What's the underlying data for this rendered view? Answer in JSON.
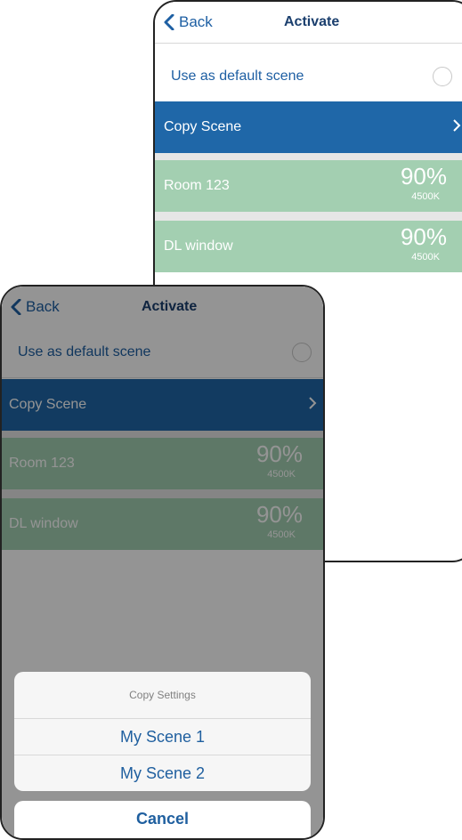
{
  "nav": {
    "back_label": "Back",
    "title": "Activate"
  },
  "scene": {
    "default_label": "Use as default scene",
    "copy_label": "Copy Scene",
    "rooms": [
      {
        "name": "Room 123",
        "level": "90%",
        "kelvin": "4500K"
      },
      {
        "name": "DL window",
        "level": "90%",
        "kelvin": "4500K"
      }
    ]
  },
  "action_sheet": {
    "title": "Copy Settings",
    "options": [
      "My Scene 1",
      "My Scene 2"
    ],
    "cancel_label": "Cancel"
  },
  "colors": {
    "accent_blue": "#1f67a8",
    "room_green": "#a3cfb1",
    "title_navy": "#1b3f6e"
  },
  "icons": {
    "back": "chevron-left-icon",
    "disclosure": "chevron-right-icon",
    "radio": "radio-empty-icon"
  }
}
